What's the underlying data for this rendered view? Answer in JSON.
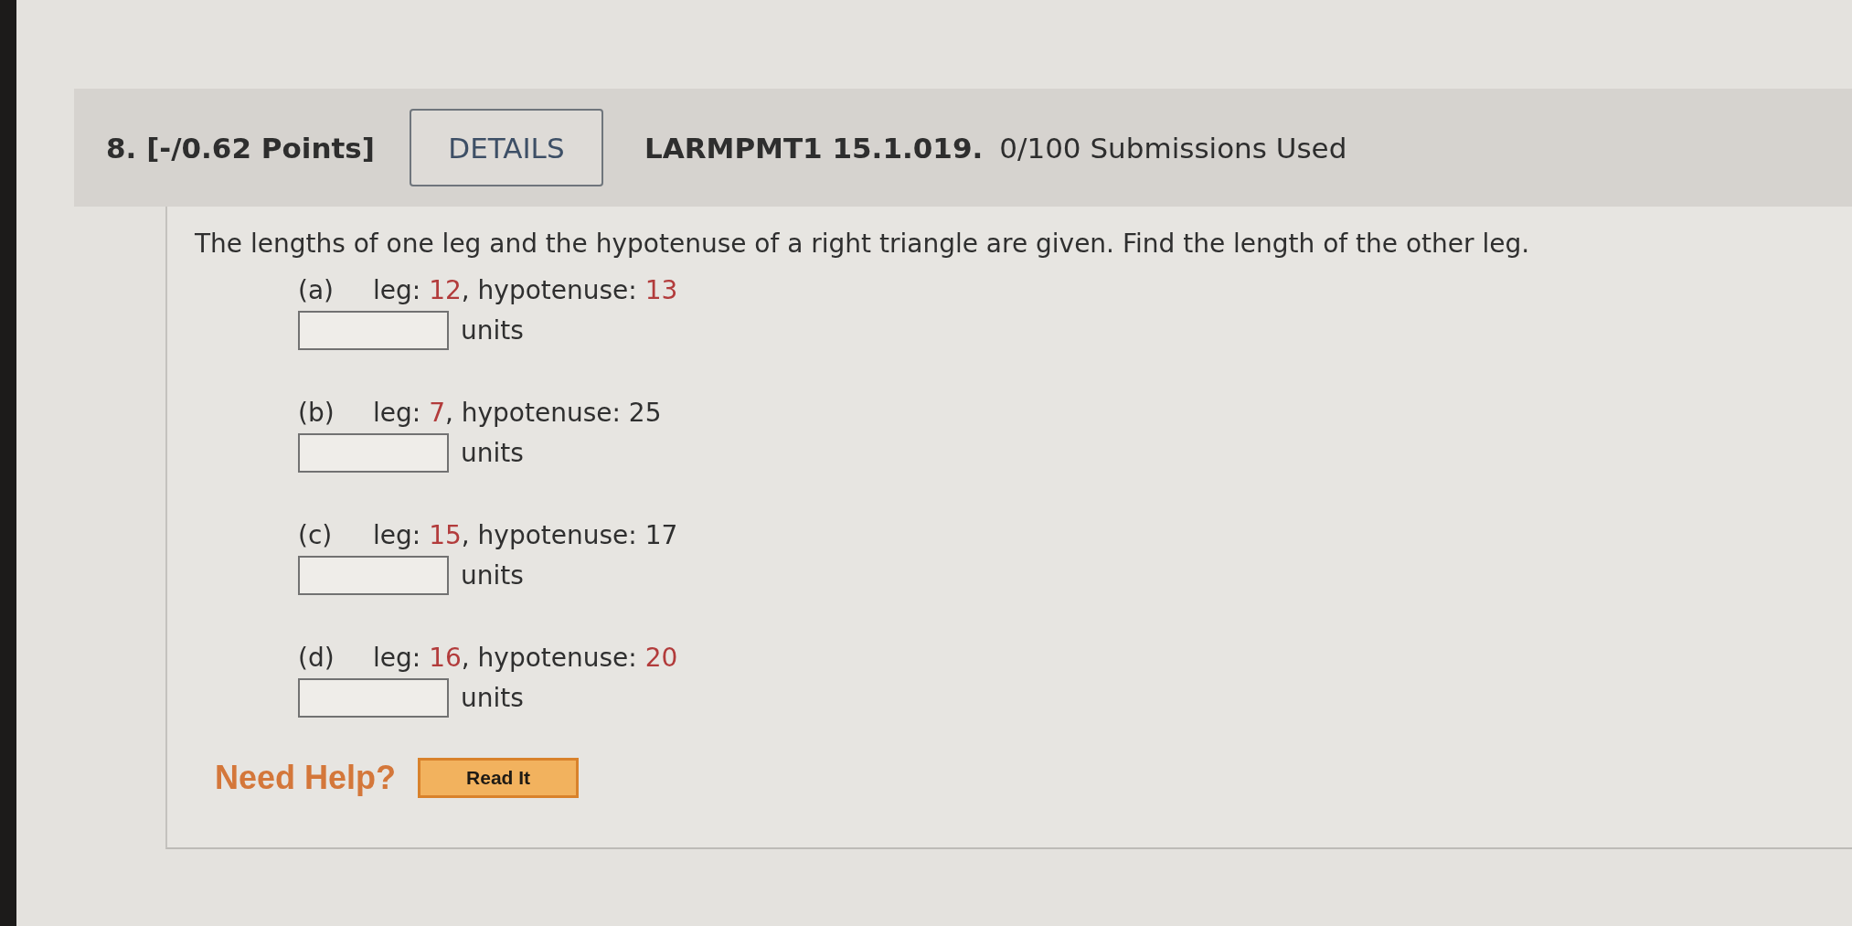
{
  "question": {
    "heading": "8. [-/0.62 Points]",
    "details_button": "DETAILS",
    "code": "LARMPMT1 15.1.019.",
    "submissions": "0/100 Submissions Used"
  },
  "prompt": "The lengths of one leg and the hypotenuse of a right triangle are given. Find the length of the other leg.",
  "parts": [
    {
      "label": "(a)",
      "statement": [
        {
          "text": "leg: ",
          "highlighted": false
        },
        {
          "text": "12",
          "highlighted": true
        },
        {
          "text": ", hypotenuse: ",
          "highlighted": false
        },
        {
          "text": "13",
          "highlighted": true
        }
      ],
      "units": "units"
    },
    {
      "label": "(b)",
      "statement": [
        {
          "text": "leg: ",
          "highlighted": false
        },
        {
          "text": "7",
          "highlighted": true
        },
        {
          "text": ", hypotenuse: ",
          "highlighted": false
        },
        {
          "text": "25",
          "highlighted": false
        }
      ],
      "units": "units"
    },
    {
      "label": "(c)",
      "statement": [
        {
          "text": "leg: ",
          "highlighted": false
        },
        {
          "text": "15",
          "highlighted": true
        },
        {
          "text": ", hypotenuse: ",
          "highlighted": false
        },
        {
          "text": "17",
          "highlighted": false
        }
      ],
      "units": "units"
    },
    {
      "label": "(d)",
      "statement": [
        {
          "text": "leg: ",
          "highlighted": false
        },
        {
          "text": "16",
          "highlighted": true
        },
        {
          "text": ", hypotenuse: ",
          "highlighted": false
        },
        {
          "text": "20",
          "highlighted": true
        }
      ],
      "units": "units"
    }
  ],
  "help": {
    "label": "Need Help?",
    "button": "Read It"
  }
}
